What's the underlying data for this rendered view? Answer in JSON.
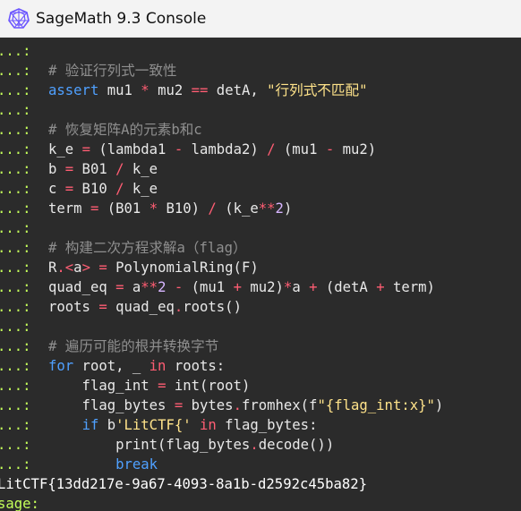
{
  "window": {
    "title": "SageMath 9.3 Console",
    "icon": "sagemath-logo-icon"
  },
  "console": {
    "continuation_prompt": "...:",
    "lines": [
      {
        "segments": []
      },
      {
        "segments": [
          {
            "t": "# 验证行列式一致性",
            "c": "c-comment"
          }
        ]
      },
      {
        "segments": [
          {
            "t": "assert",
            "c": "c-kw"
          },
          {
            "t": " mu1 "
          },
          {
            "t": "*",
            "c": "c-op"
          },
          {
            "t": " mu2 "
          },
          {
            "t": "==",
            "c": "c-op"
          },
          {
            "t": " detA, "
          },
          {
            "t": "\"行列式不匹配\"",
            "c": "c-str"
          }
        ]
      },
      {
        "segments": []
      },
      {
        "segments": [
          {
            "t": "# 恢复矩阵A的元素b和c",
            "c": "c-comment"
          }
        ]
      },
      {
        "segments": [
          {
            "t": "k_e "
          },
          {
            "t": "=",
            "c": "c-op"
          },
          {
            "t": " (lambda1 "
          },
          {
            "t": "-",
            "c": "c-op"
          },
          {
            "t": " lambda2) "
          },
          {
            "t": "/",
            "c": "c-op"
          },
          {
            "t": " (mu1 "
          },
          {
            "t": "-",
            "c": "c-op"
          },
          {
            "t": " mu2)"
          }
        ]
      },
      {
        "segments": [
          {
            "t": "b "
          },
          {
            "t": "=",
            "c": "c-op"
          },
          {
            "t": " B01 "
          },
          {
            "t": "/",
            "c": "c-op"
          },
          {
            "t": " k_e"
          }
        ]
      },
      {
        "segments": [
          {
            "t": "c "
          },
          {
            "t": "=",
            "c": "c-op"
          },
          {
            "t": " B10 "
          },
          {
            "t": "/",
            "c": "c-op"
          },
          {
            "t": " k_e"
          }
        ]
      },
      {
        "segments": [
          {
            "t": "term "
          },
          {
            "t": "=",
            "c": "c-op"
          },
          {
            "t": " (B01 "
          },
          {
            "t": "*",
            "c": "c-op"
          },
          {
            "t": " B10) "
          },
          {
            "t": "/",
            "c": "c-op"
          },
          {
            "t": " (k_e"
          },
          {
            "t": "**",
            "c": "c-op"
          },
          {
            "t": "2",
            "c": "c-num"
          },
          {
            "t": ")"
          }
        ]
      },
      {
        "segments": []
      },
      {
        "segments": [
          {
            "t": "# 构建二次方程求解a（flag）",
            "c": "c-comment"
          }
        ]
      },
      {
        "segments": [
          {
            "t": "R"
          },
          {
            "t": ".<",
            "c": "c-op"
          },
          {
            "t": "a"
          },
          {
            "t": ">",
            "c": "c-op"
          },
          {
            "t": " "
          },
          {
            "t": "=",
            "c": "c-op"
          },
          {
            "t": " PolynomialRing(F)"
          }
        ]
      },
      {
        "segments": [
          {
            "t": "quad_eq "
          },
          {
            "t": "=",
            "c": "c-op"
          },
          {
            "t": " a"
          },
          {
            "t": "**",
            "c": "c-op"
          },
          {
            "t": "2",
            "c": "c-num"
          },
          {
            "t": " "
          },
          {
            "t": "-",
            "c": "c-op"
          },
          {
            "t": " (mu1 "
          },
          {
            "t": "+",
            "c": "c-op"
          },
          {
            "t": " mu2)"
          },
          {
            "t": "*",
            "c": "c-op"
          },
          {
            "t": "a "
          },
          {
            "t": "+",
            "c": "c-op"
          },
          {
            "t": " (detA "
          },
          {
            "t": "+",
            "c": "c-op"
          },
          {
            "t": " term)"
          }
        ]
      },
      {
        "segments": [
          {
            "t": "roots "
          },
          {
            "t": "=",
            "c": "c-op"
          },
          {
            "t": " quad_eq"
          },
          {
            "t": ".",
            "c": "c-op"
          },
          {
            "t": "roots()"
          }
        ]
      },
      {
        "segments": []
      },
      {
        "segments": [
          {
            "t": "# 遍历可能的根并转换字节",
            "c": "c-comment"
          }
        ]
      },
      {
        "segments": [
          {
            "t": "for",
            "c": "c-kw"
          },
          {
            "t": " root, _ "
          },
          {
            "t": "in",
            "c": "c-op"
          },
          {
            "t": " roots:"
          }
        ]
      },
      {
        "segments": [
          {
            "t": "    flag_int "
          },
          {
            "t": "=",
            "c": "c-op"
          },
          {
            "t": " int(root)"
          }
        ]
      },
      {
        "segments": [
          {
            "t": "    flag_bytes "
          },
          {
            "t": "=",
            "c": "c-op"
          },
          {
            "t": " bytes"
          },
          {
            "t": ".",
            "c": "c-op"
          },
          {
            "t": "fromhex(f"
          },
          {
            "t": "\"{flag_int:x}\"",
            "c": "c-str"
          },
          {
            "t": ")"
          }
        ]
      },
      {
        "segments": [
          {
            "t": "    "
          },
          {
            "t": "if",
            "c": "c-kw"
          },
          {
            "t": " b"
          },
          {
            "t": "'LitCTF{'",
            "c": "c-str"
          },
          {
            "t": " "
          },
          {
            "t": "in",
            "c": "c-op"
          },
          {
            "t": " flag_bytes:"
          }
        ]
      },
      {
        "segments": [
          {
            "t": "        print(flag_bytes"
          },
          {
            "t": ".",
            "c": "c-op"
          },
          {
            "t": "decode())"
          }
        ]
      },
      {
        "segments": [
          {
            "t": "        "
          },
          {
            "t": "break",
            "c": "c-kw"
          }
        ]
      }
    ],
    "output": "LitCTF{13dd217e-9a67-4093-8a1b-d2592c45ba82}",
    "sage_prompt": "sage:"
  },
  "colors": {
    "prompt": "#c4ff5a",
    "comment": "#8f8f8f",
    "keyword": "#4fa0ff",
    "operator": "#ff5d73",
    "string": "#ffe38a",
    "number": "#d6b5ff",
    "text": "#e8e8e8",
    "background": "#2b2b2b"
  }
}
